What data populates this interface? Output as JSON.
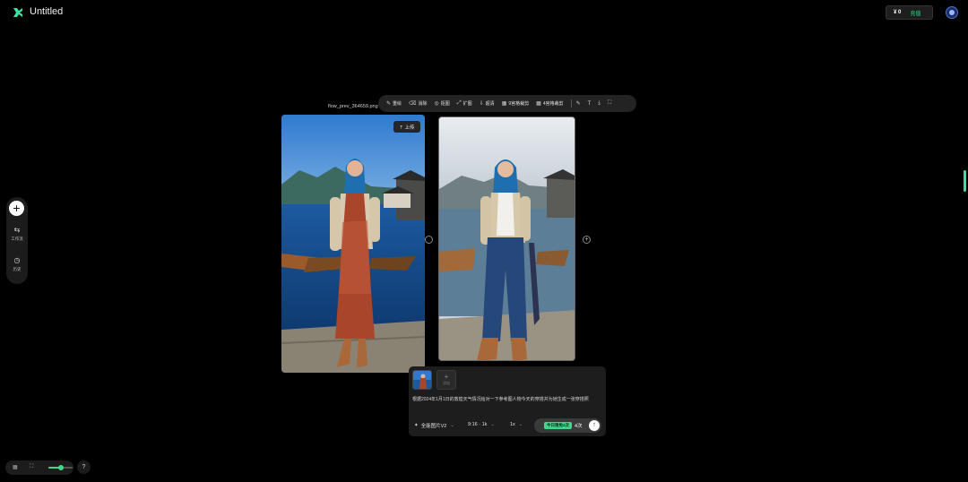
{
  "header": {
    "title": "Untitled",
    "credits_value": "¥ 0",
    "recharge_label": "充值"
  },
  "rail": {
    "add_symbol": "+",
    "workflow_label": "工作流",
    "history_label": "历史"
  },
  "canvas": {
    "filename": "flow_prev_364659.png",
    "upload_label": "⇡ 上传"
  },
  "toolbar": {
    "items": [
      {
        "icon": "✎",
        "label": "重绘"
      },
      {
        "icon": "⌫",
        "label": "消除"
      },
      {
        "icon": "◎",
        "label": "抠图"
      },
      {
        "icon": "⤢",
        "label": "扩图"
      },
      {
        "icon": "⇩",
        "label": "超清"
      },
      {
        "icon": "▦",
        "label": "9宫格裁剪"
      },
      {
        "icon": "▦",
        "label": "4宫格裁剪"
      }
    ],
    "tail_icons": [
      "✎",
      "T",
      "⤓",
      "⛶"
    ]
  },
  "prompt_panel": {
    "add_label": "添加",
    "prompt_text": "根据2024年1月1日的敦煌天气情况给对一下参考图人物今天的穿搭并为她生成一张穿搭照",
    "model": "全能图片V2",
    "ratio": "9:16 · 1k",
    "count": "1x",
    "badge": "今日限免2次",
    "remaining": "4次"
  },
  "bottom_bar": {
    "zoom_fraction": 0.5
  }
}
